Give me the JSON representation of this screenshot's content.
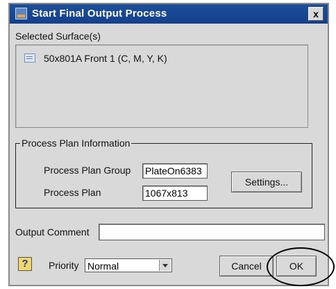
{
  "window": {
    "title": "Start Final Output Process",
    "close_label": "x"
  },
  "selected_surfaces": {
    "label": "Selected Surface(s)",
    "items": [
      "50x801A Front 1 (C, M, Y, K)"
    ]
  },
  "process_plan_info": {
    "legend": "Process Plan Information",
    "group_label": "Process Plan Group",
    "group_value": "PlateOn6383",
    "plan_label": "Process Plan",
    "plan_value": "1067x813",
    "settings_button": "Settings..."
  },
  "output_comment": {
    "label": "Output Comment",
    "value": ""
  },
  "footer": {
    "help_label": "?",
    "priority_label": "Priority",
    "priority_value": "Normal",
    "cancel_button": "Cancel",
    "ok_button": "OK"
  },
  "colors": {
    "titlebar": "#1c4f9a",
    "dialog_bg": "#d9d9d9"
  },
  "icons": [
    "app-icon",
    "close-icon",
    "surface-icon",
    "help-icon",
    "chevron-down-icon"
  ]
}
